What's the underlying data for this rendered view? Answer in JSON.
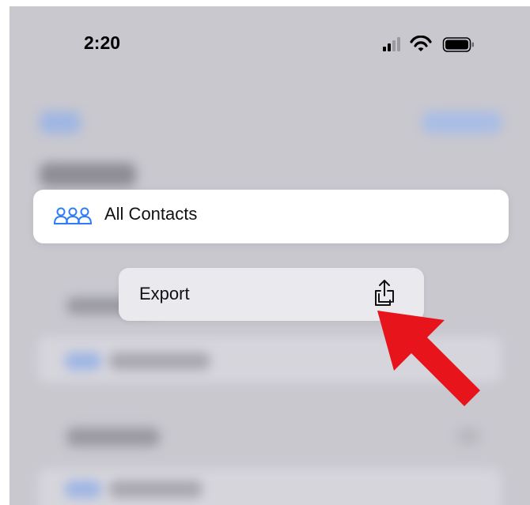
{
  "status_bar": {
    "time": "2:20",
    "icons": [
      "cellular-signal-icon",
      "wifi-icon",
      "battery-icon"
    ]
  },
  "context_menu": {
    "header_label": "All Contacts",
    "header_icon": "people-group-icon",
    "items": [
      {
        "label": "Export",
        "icon": "share-icon"
      }
    ]
  },
  "annotation": {
    "type": "red-pointer-arrow",
    "color": "#e8141c",
    "target": "Export"
  },
  "colors": {
    "accent": "#2f7df6",
    "background_blur": "#c9c8cf",
    "menu_bg": "#ffffff",
    "item_bg": "#e9e9ee"
  }
}
